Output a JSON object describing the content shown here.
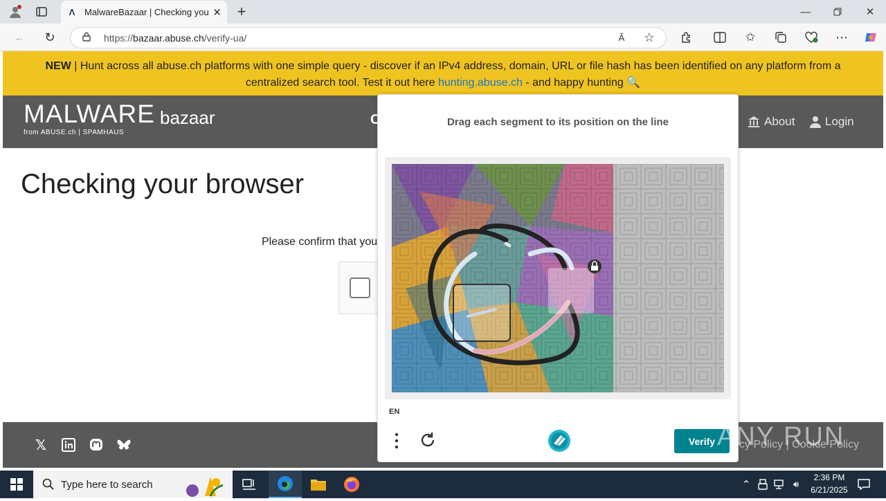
{
  "browser": {
    "tab_title": "MalwareBazaar | Checking your b",
    "url_scheme": "https://",
    "url_host": "bazaar.abuse.ch",
    "url_path": "/verify-ua/"
  },
  "banner": {
    "new_label": "NEW",
    "text": " | Hunt across all abuse.ch platforms with one simple query - discover if an IPv4 address, domain, URL or file hash has been identified on any platform from a centralized search tool. Test it out here ",
    "link": "hunting.abuse.ch",
    "text_after": " - and happy hunting 🔍"
  },
  "site": {
    "logo_main": "MALWARE",
    "logo_sub": "bazaar",
    "logo_from": "from ABUSE.ch | SPAMHAUS",
    "nav_c": "C",
    "nav_about": "About",
    "nav_login": "Login",
    "page_title": "Checking your browser",
    "confirm_text": "Please confirm that you",
    "footer_links": "cy Policy  |  Cookie Policy"
  },
  "challenge": {
    "prompt": "Drag each segment to its position on the line",
    "language": "EN",
    "verify_label": "Verify"
  },
  "watermark": "ANY RUN",
  "taskbar": {
    "search_placeholder": "Type here to search",
    "time": "2:36 PM",
    "date": "6/21/2025"
  },
  "colors": {
    "banner": "#f0c420",
    "nav": "#595959",
    "verify": "#00838f",
    "taskbar": "#1c2c3c"
  }
}
